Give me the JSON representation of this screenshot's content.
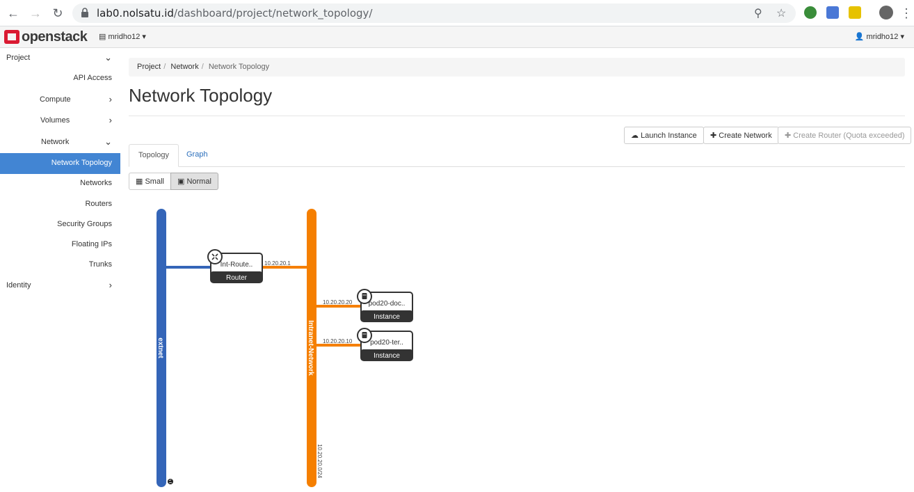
{
  "browser": {
    "url_host": "lab0.nolsatu.id",
    "url_path": "/dashboard/project/network_topology/"
  },
  "header": {
    "logo_text": "openstack",
    "project": "mridho12",
    "user": "mridho12"
  },
  "sidebar": {
    "items": [
      {
        "label": "Project",
        "chevron": "down"
      },
      {
        "label": "API Access"
      },
      {
        "label": "Compute",
        "chevron": "right"
      },
      {
        "label": "Volumes",
        "chevron": "right"
      },
      {
        "label": "Network",
        "chevron": "down"
      },
      {
        "label": "Network Topology",
        "active": true
      },
      {
        "label": "Networks"
      },
      {
        "label": "Routers"
      },
      {
        "label": "Security Groups"
      },
      {
        "label": "Floating IPs"
      },
      {
        "label": "Trunks"
      },
      {
        "label": "Identity",
        "chevron": "right"
      }
    ]
  },
  "breadcrumb": {
    "project": "Project",
    "network": "Network",
    "current": "Network Topology"
  },
  "page": {
    "title": "Network Topology"
  },
  "actions": {
    "launch": "Launch Instance",
    "create_network": "Create Network",
    "create_router": "Create Router (Quota exceeded)"
  },
  "tabs": {
    "topology": "Topology",
    "graph": "Graph"
  },
  "size": {
    "small": "Small",
    "normal": "Normal"
  },
  "topology": {
    "networks": [
      {
        "name": "extnet",
        "color": "#3465b8"
      },
      {
        "name": "Intranet-Network",
        "cidr": "10.20.20.0/24",
        "color": "#f57f00"
      }
    ],
    "router": {
      "name": "Int-Route..",
      "type": "Router",
      "ip": "10.20.20.1"
    },
    "instances": [
      {
        "name": "pod20-doc..",
        "type": "Instance",
        "ip": "10.20.20.20"
      },
      {
        "name": "pod20-ter..",
        "type": "Instance",
        "ip": "10.20.20.10"
      }
    ]
  },
  "colors": {
    "accent": "#4285d3",
    "extnet": "#3465b8",
    "intranet": "#f57f00"
  }
}
